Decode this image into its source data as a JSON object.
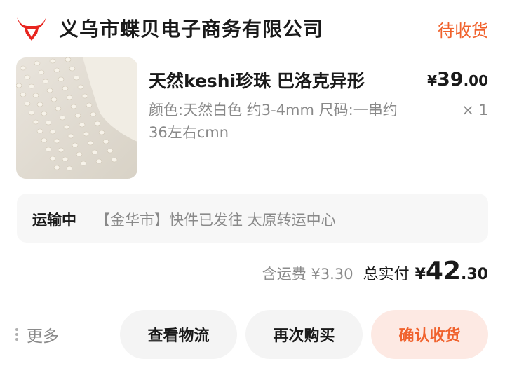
{
  "shop": {
    "name": "义乌市蝶贝电子商务有限公司",
    "logo_icon": "bull-head-icon",
    "logo_color": "#e8251f"
  },
  "order": {
    "status": "待收货"
  },
  "product": {
    "title": "天然keshi珍珠  巴洛克异形",
    "spec": "颜色:天然白色 约3-4mm 尺码:一串约36左右cmn",
    "price_symbol": "¥",
    "price_int": "39",
    "price_dec": ".00",
    "quantity": "× 1"
  },
  "logistics": {
    "status": "运输中",
    "detail": "【金华市】快件已发往 太原转运中心"
  },
  "totals": {
    "shipping": "含运费 ¥3.30",
    "total_label": "总实付",
    "total_symbol": "¥",
    "total_int": "42",
    "total_dec": ".30"
  },
  "actions": {
    "more_label": "更多",
    "view_logistics": "查看物流",
    "rebuy": "再次购买",
    "confirm_receipt": "确认收货"
  },
  "colors": {
    "accent": "#f0622d",
    "confirm_bg": "#fde9e3",
    "button_bg": "#f4f4f4",
    "muted_text": "#8a8a8a"
  }
}
